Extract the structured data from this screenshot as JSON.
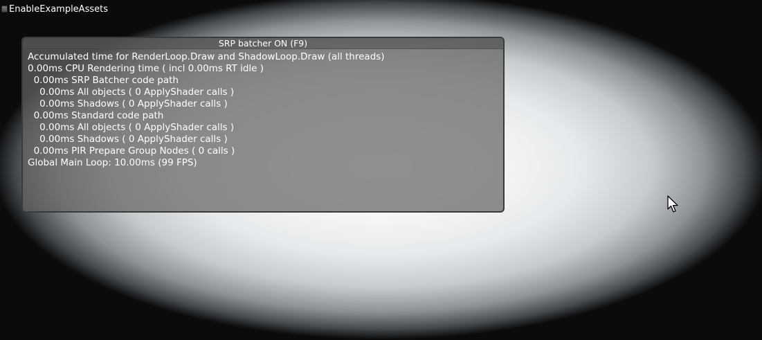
{
  "toggle": {
    "label": "EnableExampleAssets"
  },
  "panel": {
    "title": "SRP batcher ON (F9)",
    "lines": [
      "Accumulated time for RenderLoop.Draw and ShadowLoop.Draw (all threads)",
      "0.00ms CPU Rendering time ( incl 0.00ms RT idle )",
      "  0.00ms SRP Batcher code path",
      "    0.00ms All objects ( 0 ApplyShader calls )",
      "    0.00ms Shadows ( 0 ApplyShader calls )",
      "  0.00ms Standard code path",
      "    0.00ms All objects ( 0 ApplyShader calls )",
      "    0.00ms Shadows ( 0 ApplyShader calls )",
      "  0.00ms PIR Prepare Group Nodes ( 0 calls )",
      "Global Main Loop: 10.00ms (99 FPS)"
    ]
  },
  "cursor": {
    "icon": "mouse-pointer-icon"
  }
}
